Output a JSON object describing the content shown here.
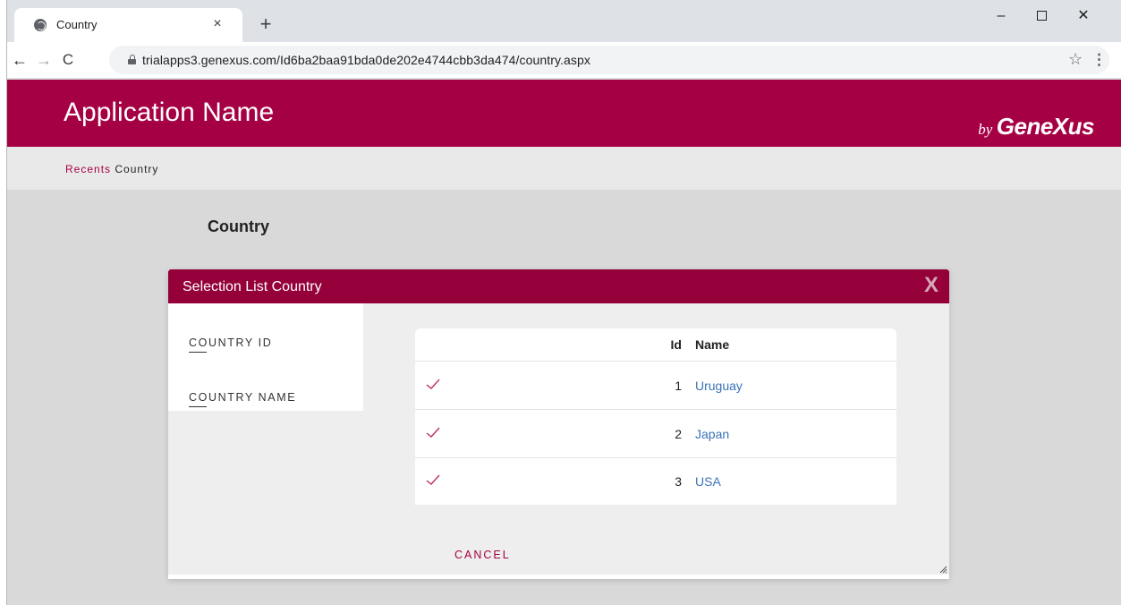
{
  "browser": {
    "tab_title": "Country",
    "tab_close": "×",
    "new_tab": "+",
    "url": "trialapps3.genexus.com/Id6ba2baa91bda0de202e4744cbb3da474/country.aspx",
    "back": "←",
    "forward": "→",
    "reload": "C",
    "star": "☆",
    "menu": "⋮",
    "minimize": "–",
    "close": "✕"
  },
  "app": {
    "name": "Application Name",
    "brand_by": "by",
    "brand_name": "GeneXus",
    "accent_color": "#a50043"
  },
  "breadcrumb": {
    "link": "Recents",
    "current": "Country"
  },
  "page": {
    "title": "Country"
  },
  "modal": {
    "title": "Selection List Country",
    "close": "X",
    "filters": [
      "COUNTRY ID",
      "COUNTRY NAME"
    ],
    "columns": {
      "id": "Id",
      "name": "Name"
    },
    "rows": [
      {
        "id": "1",
        "name": "Uruguay"
      },
      {
        "id": "2",
        "name": "Japan"
      },
      {
        "id": "3",
        "name": "USA"
      }
    ],
    "cancel_label": "CANCEL"
  }
}
